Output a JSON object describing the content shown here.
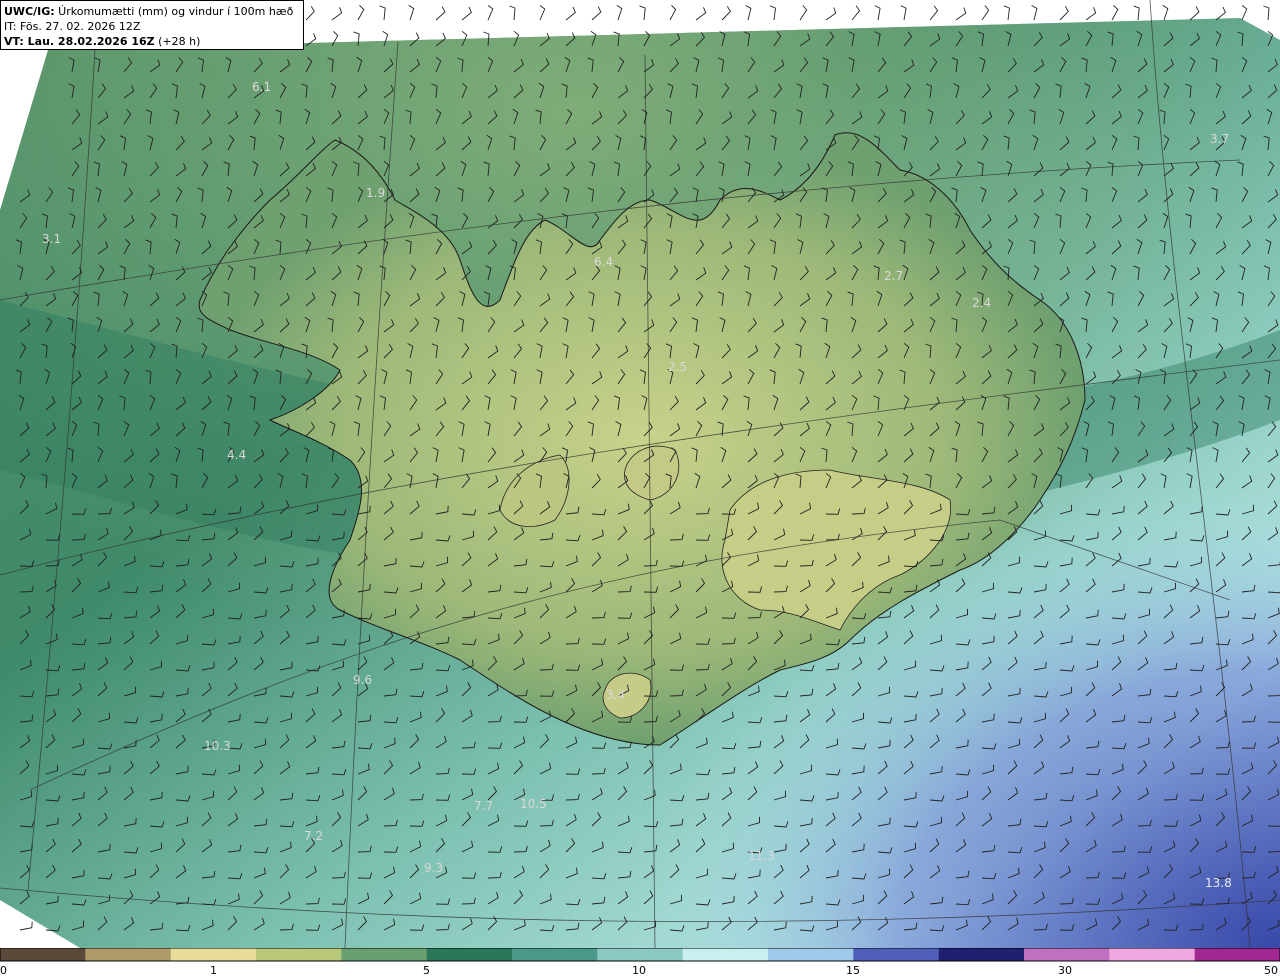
{
  "header": {
    "line1_bold": "UWC/IG:",
    "line1_rest": " Úrkomumætti (mm) og vindur í 100m hæð",
    "line2": "IT: Fös. 27. 02. 2026 12Z",
    "line3_bold": "VT: Lau. 28.02.2026 16Z",
    "line3_rest": " (+28 h)"
  },
  "values": [
    {
      "text": "6.1"
    },
    {
      "text": "3.1"
    },
    {
      "text": "1.9"
    },
    {
      "text": "6.4"
    },
    {
      "text": "2.7"
    },
    {
      "text": "2.4"
    },
    {
      "text": "3.7"
    },
    {
      "text": "2.5"
    },
    {
      "text": "4.4"
    },
    {
      "text": "3.4"
    },
    {
      "text": "9.6"
    },
    {
      "text": "10.3"
    },
    {
      "text": "7.7"
    },
    {
      "text": "10.5"
    },
    {
      "text": "7.2"
    },
    {
      "text": "9.3"
    },
    {
      "text": "11.3"
    },
    {
      "text": "13.8"
    }
  ],
  "colorbar": {
    "ticks": [
      "0",
      "1",
      "5",
      "10",
      "15",
      "30",
      "50"
    ],
    "colors": [
      "#5a4a3a",
      "#b09a6a",
      "#e8dc98",
      "#b8c878",
      "#6aa070",
      "#2a7858",
      "#4a9888",
      "#8cc8c4",
      "#c8f0f0",
      "#a0c8e8",
      "#5060b8",
      "#202070",
      "#c070c0",
      "#f0a8e0",
      "#a02890"
    ]
  }
}
